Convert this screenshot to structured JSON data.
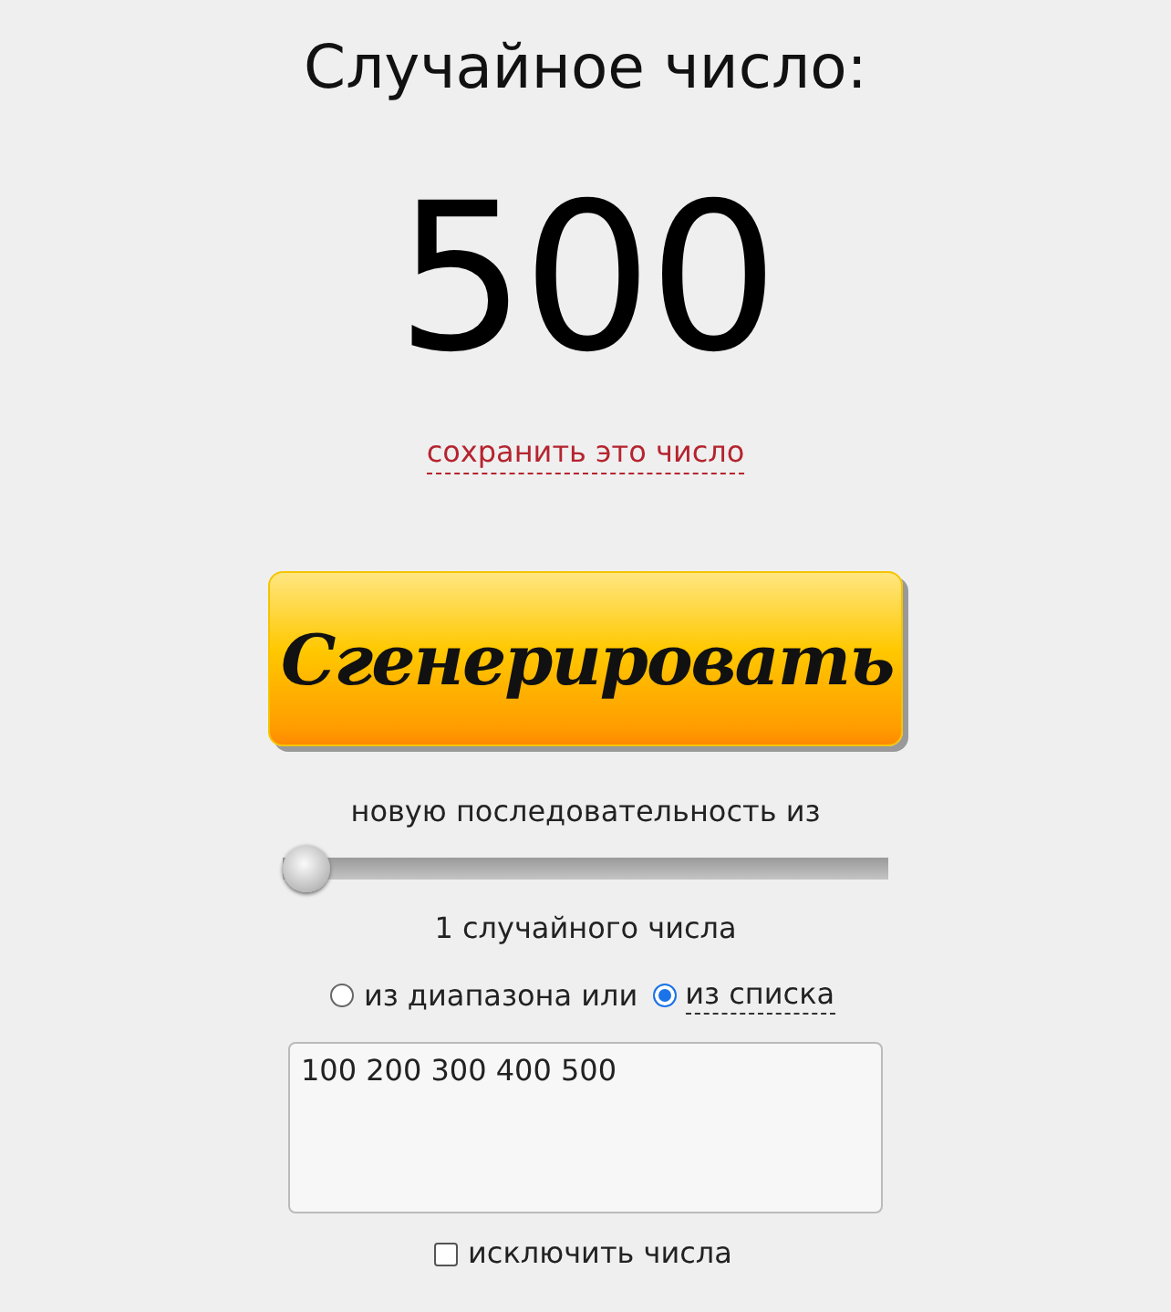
{
  "title": "Случайное число:",
  "result": "500",
  "save_link": "сохранить это число",
  "generate_button": "Сгенерировать",
  "sequence_label": "новую последовательность из",
  "count_slider": {
    "level": 0
  },
  "count_label": "1 случайного числа",
  "source_options": [
    {
      "label": "из диапазона или",
      "selected": false,
      "kind": "plain"
    },
    {
      "label": "из списка",
      "selected": true,
      "kind": "link"
    }
  ],
  "list_field": {
    "value": "100 200 300 400 500"
  },
  "exclude": {
    "label": "исключить числа",
    "checked": false
  }
}
